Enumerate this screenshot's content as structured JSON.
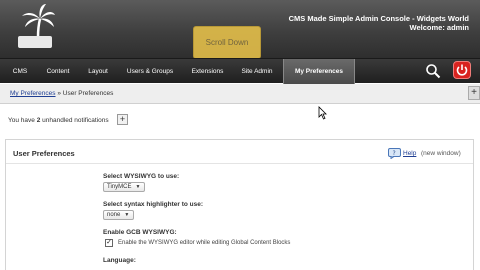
{
  "header": {
    "scroll_overlay": "Scroll Down",
    "site_title": "CMS Made Simple Admin Console - Widgets World",
    "welcome": "Welcome: admin"
  },
  "nav": {
    "items": [
      {
        "label": "CMS"
      },
      {
        "label": "Content"
      },
      {
        "label": "Layout"
      },
      {
        "label": "Users & Groups"
      },
      {
        "label": "Extensions"
      },
      {
        "label": "Site Admin"
      },
      {
        "label": "My Preferences"
      }
    ],
    "active": "My Preferences"
  },
  "breadcrumb": {
    "link": "My Preferences",
    "separator": " » ",
    "current": "User Preferences"
  },
  "notifications": {
    "prefix": "You have ",
    "count": "2",
    "suffix": " unhandled notifications"
  },
  "panel": {
    "title": "User Preferences",
    "help_link": "Help",
    "help_note": "(new window)",
    "fields": {
      "wysiwyg_label": "Select WYSIWYG to use:",
      "wysiwyg_value": "TinyMCE",
      "syntax_label": "Select syntax highlighter to use:",
      "syntax_value": "none",
      "gcb_label": "Enable GCB WYSIWYG:",
      "gcb_checkbox_text": "Enable the WYSIWYG editor while editing Global Content Blocks",
      "language_label": "Language:"
    }
  },
  "colors": {
    "header_bg": "#3f3f3f",
    "overlay": "#e8c24a",
    "link": "#1f3e93",
    "power_button": "#d9231f"
  },
  "icons": [
    "palm-tree-logo-icon",
    "search-icon",
    "power-icon",
    "plus-icon",
    "help-icon",
    "cursor-icon",
    "chevron-down-icon"
  ]
}
